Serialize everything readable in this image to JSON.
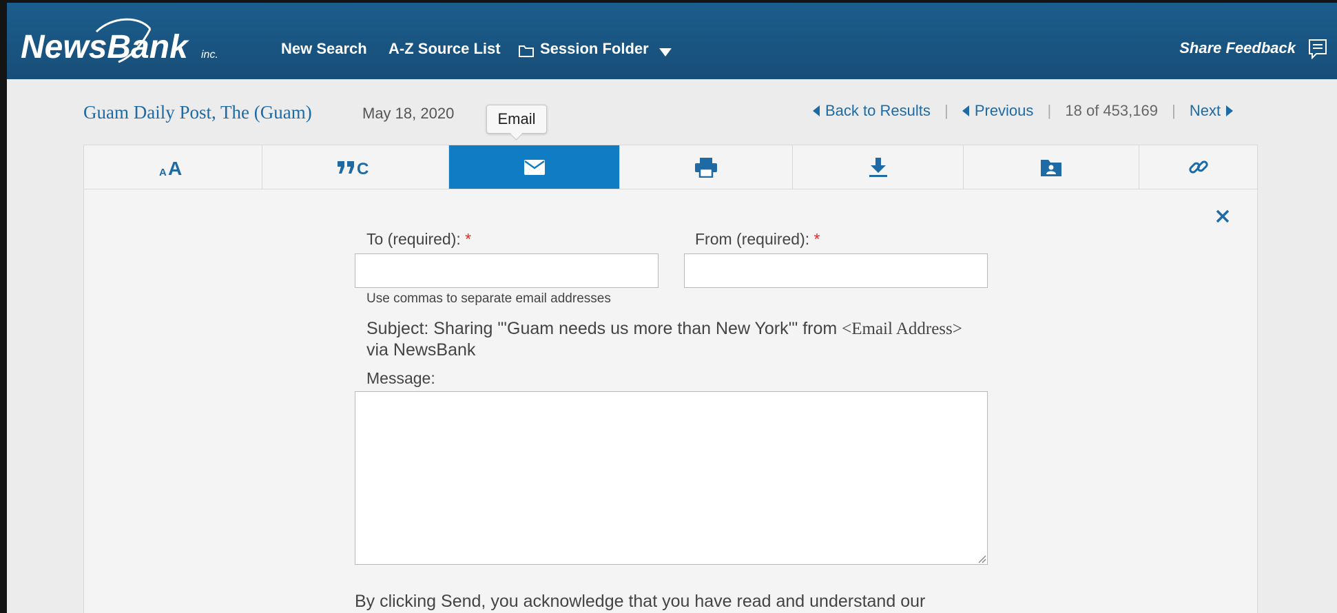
{
  "header": {
    "logo_text": "NewsBank",
    "logo_suffix": "inc.",
    "nav": {
      "new_search": "New Search",
      "az_source_list": "A-Z Source List",
      "session_folder": "Session Folder"
    },
    "share_feedback": "Share Feedback"
  },
  "document": {
    "source": "Guam Daily Post, The (Guam)",
    "date": "May 18, 2020"
  },
  "pager": {
    "back": "Back to Results",
    "previous": "Previous",
    "position": "18 of 453,169",
    "next": "Next",
    "separator": "|"
  },
  "toolbar": {
    "active_tooltip": "Email",
    "tools": [
      "font-size",
      "cite",
      "email",
      "print",
      "download",
      "save-to-folder",
      "link"
    ],
    "active_color": "#0f7cc4"
  },
  "email_form": {
    "to_label": "To (required):",
    "from_label": "From (required):",
    "required_mark": "*",
    "to_value": "",
    "from_value": "",
    "helper": "Use commas to separate email addresses",
    "subject_prefix": "Subject: Sharing \"'Guam needs us more than New York'\" from ",
    "subject_email": "<Email Address>",
    "subject_suffix": " via NewsBank",
    "message_label": "Message:",
    "message_value": "",
    "disclaimer": "By clicking Send, you acknowledge that you have read and understand our"
  },
  "colors": {
    "header": "#1c5d8d",
    "link": "#1d6aa5",
    "required": "#d9302c"
  }
}
